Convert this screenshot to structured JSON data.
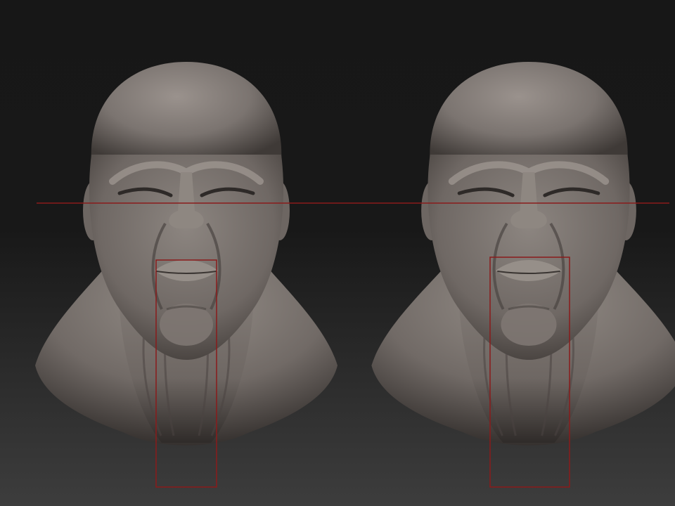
{
  "canvas": {
    "background_top": "#151515",
    "background_bottom": "#3c3c3c",
    "clay_color": "#7a736f",
    "clay_highlight": "#b9b1ab",
    "clay_shadow": "#403b38",
    "guide_color": "#8a1b1b"
  },
  "sculpts": [
    {
      "name": "head-sculpt-original"
    },
    {
      "name": "head-sculpt-revised"
    }
  ],
  "guides": {
    "eye_line": "horizontal-red-guide",
    "mouth_boxes": [
      "mouth-guide-box-left",
      "mouth-guide-box-right"
    ]
  }
}
